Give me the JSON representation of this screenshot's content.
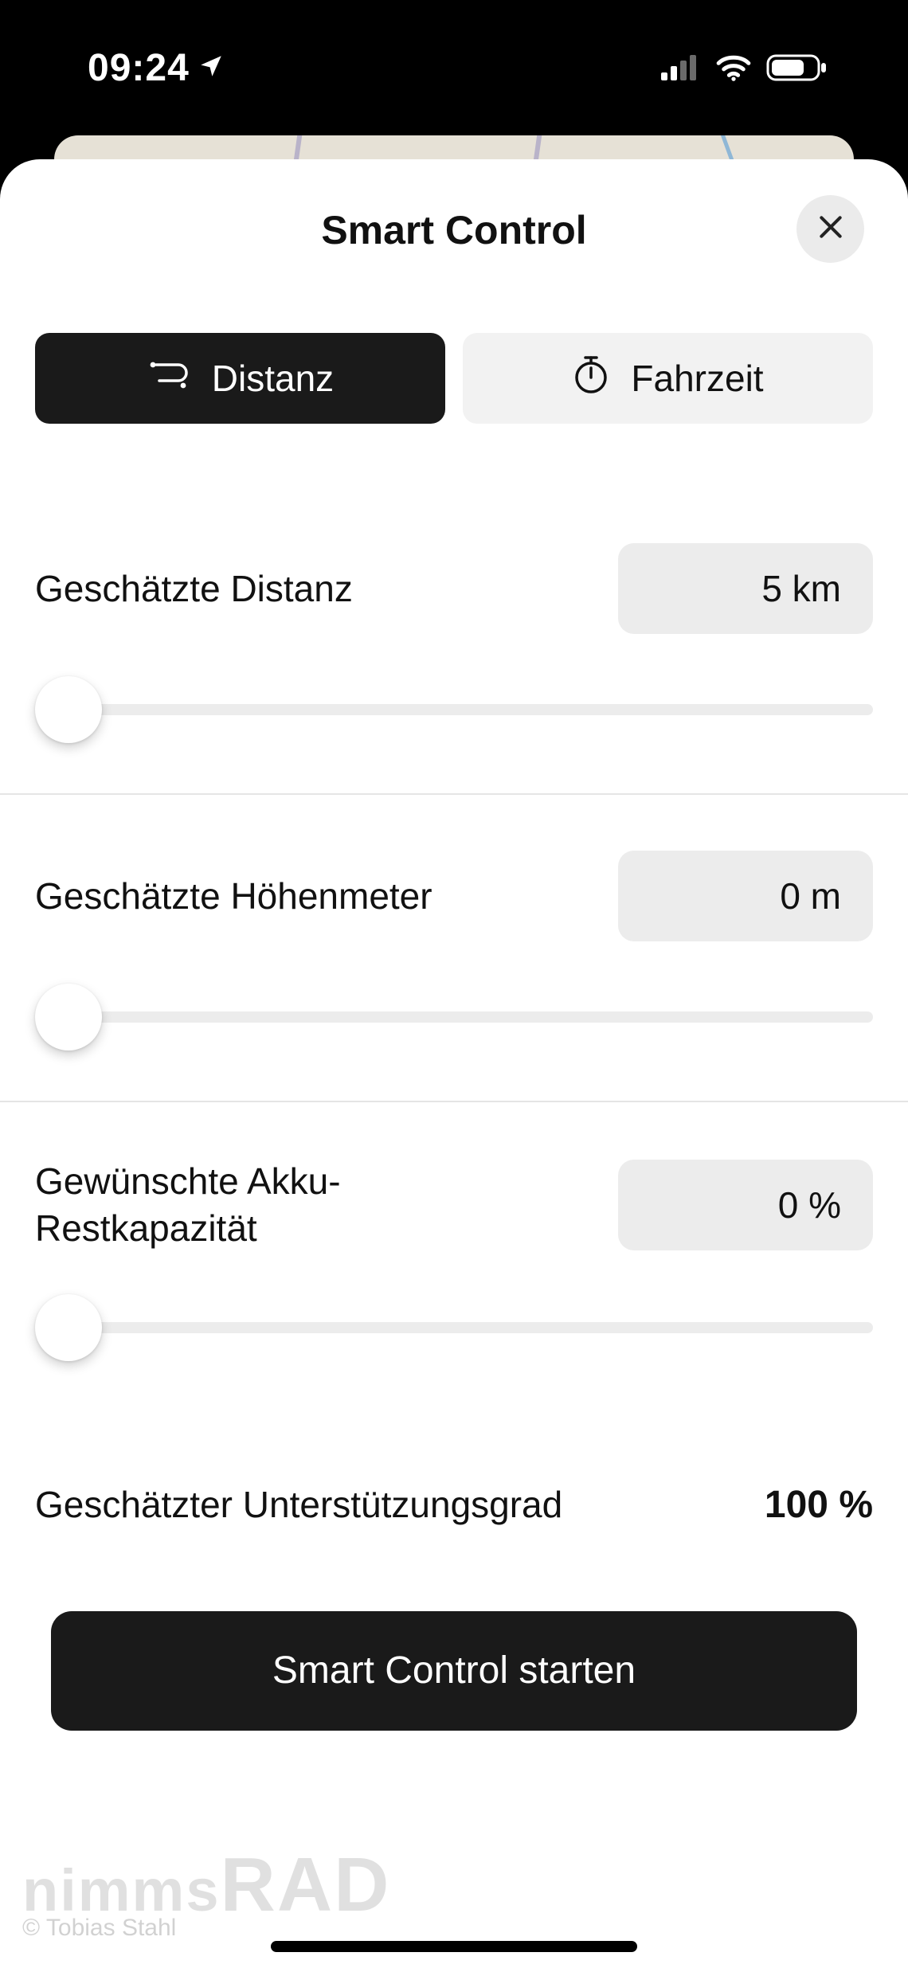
{
  "status": {
    "time": "09:24",
    "location_icon": "location-arrow",
    "signal_icon": "cellular",
    "wifi_icon": "wifi",
    "battery_icon": "battery"
  },
  "sheet": {
    "title": "Smart Control",
    "close_icon": "close-x"
  },
  "tabs": {
    "distance": {
      "label": "Distanz",
      "icon": "route-icon",
      "active": true
    },
    "time": {
      "label": "Fahrzeit",
      "icon": "stopwatch-icon",
      "active": false
    }
  },
  "sliders": {
    "distance": {
      "label": "Geschätzte Distanz",
      "value": "5 km",
      "position_pct": 4
    },
    "elevation": {
      "label": "Geschätzte Höhenmeter",
      "value": "0 m",
      "position_pct": 4
    },
    "battery": {
      "label": "Gewünschte Akku-Restkapazität",
      "value": "0 %",
      "position_pct": 4
    }
  },
  "support": {
    "label": "Geschätzter Unterstützungsgrad",
    "value": "100 %"
  },
  "cta": {
    "label": "Smart Control starten"
  },
  "watermark": {
    "brand_part1": "nimms",
    "brand_part2": "RAD",
    "credit": "© Tobias Stahl"
  }
}
